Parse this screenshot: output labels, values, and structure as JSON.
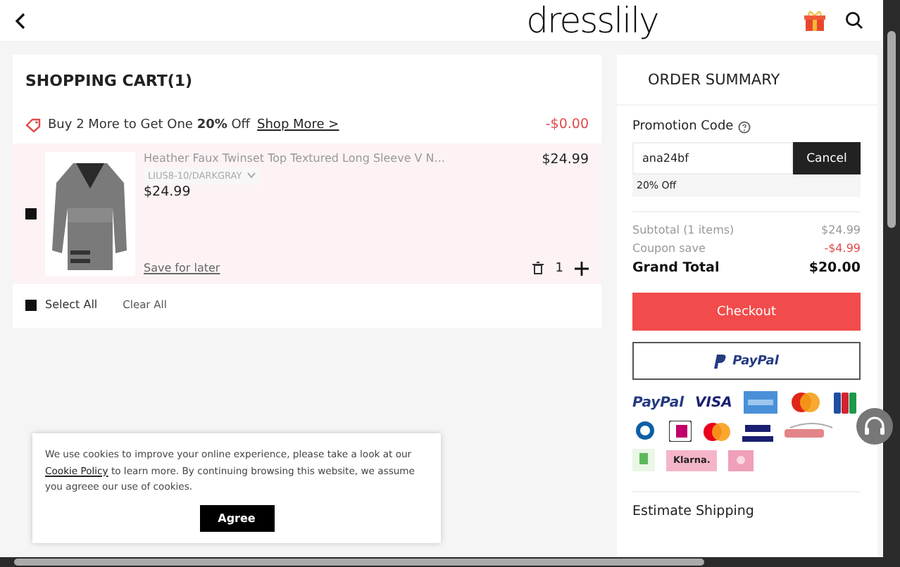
{
  "header": {
    "logo": "dresslily"
  },
  "cart": {
    "title": "SHOPPING CART(1)",
    "promo": {
      "text": "Buy 2 More to Get One **20%** Off",
      "link": "Shop More >",
      "discount": "-$0.00"
    },
    "items": [
      {
        "name": "Heather Faux Twinset Top Textured Long Sleeve V N...",
        "variant": "LIUS8-10/DARKGRAY",
        "price": "$24.99",
        "unit_price": "$24.99",
        "save_label": "Save for later",
        "quantity": "1",
        "checked": true
      }
    ],
    "select_all": {
      "label": "Select All",
      "checked": true
    },
    "clear_all": "Clear All"
  },
  "summary": {
    "title": "ORDER SUMMARY",
    "promotion_label": "Promotion Code",
    "code_value": "ana24bf",
    "cancel": "Cancel",
    "code_note": "20% Off",
    "lines": [
      {
        "label": "Subtotal (1 items)",
        "value": "$24.99",
        "kind": "plain"
      },
      {
        "label": "Coupon save",
        "value": "-$4.99",
        "kind": "discount"
      },
      {
        "label": "Grand Total",
        "value": "$20.00",
        "kind": "total"
      }
    ],
    "checkout": "Checkout",
    "paypal": "PayPal",
    "payments": [
      {
        "kind": "text",
        "text": "PayPal",
        "color": "#253b80"
      },
      {
        "kind": "text",
        "text": "VISA",
        "color": "#1a1f71"
      },
      {
        "kind": "amex"
      },
      {
        "kind": "maestro"
      },
      {
        "kind": "jcb"
      },
      {
        "kind": "diners"
      },
      {
        "kind": "ideal"
      },
      {
        "kind": "mastercard"
      },
      {
        "kind": "visa-debit"
      },
      {
        "kind": "przelewy"
      },
      {
        "kind": "green"
      },
      {
        "kind": "pill",
        "text": "Klarna.",
        "color": "#f5b5c8"
      },
      {
        "kind": "pill-icon",
        "color": "#f0a0b8"
      }
    ],
    "shipping_title": "Estimate Shipping"
  },
  "cookie": {
    "text": "We use cookies to improve your online experience, please take a look at our",
    "link": "Cookie Policy",
    "text_after": " to learn more. By continuing browsing this website, we assume you agreee our use of cookies.",
    "button": "Agree"
  }
}
